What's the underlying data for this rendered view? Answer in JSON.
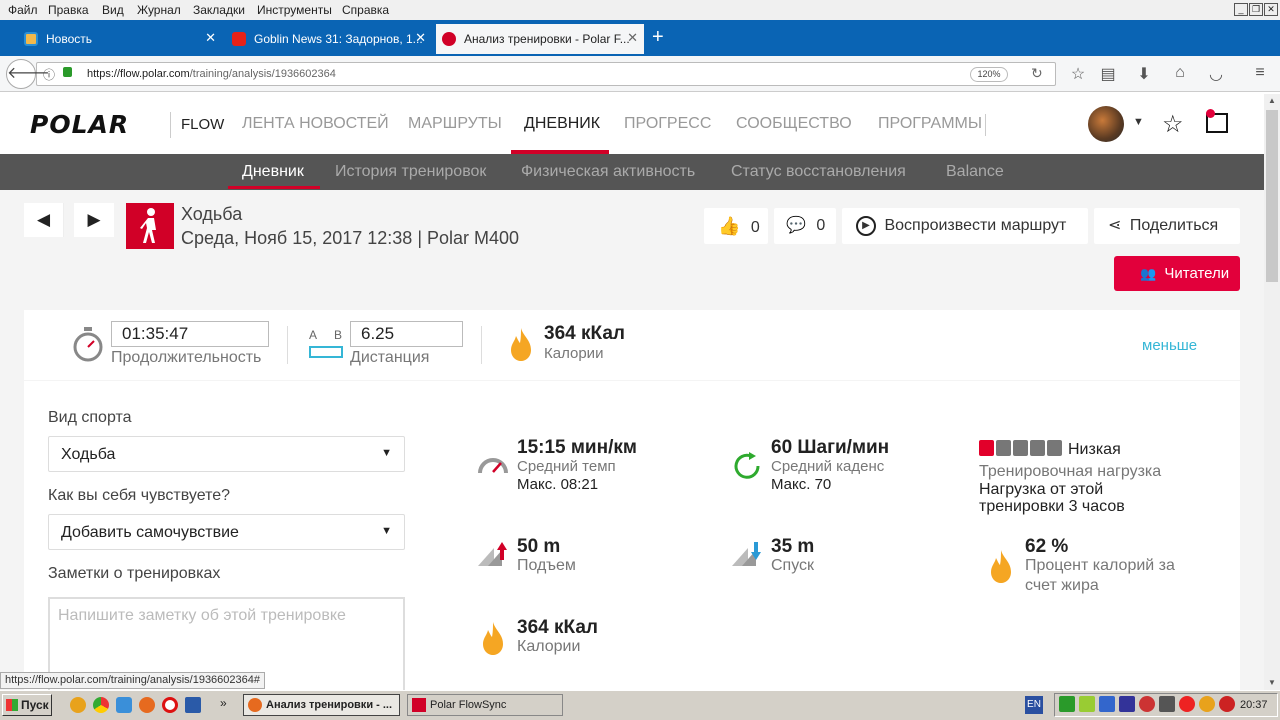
{
  "browser": {
    "menu": [
      "Файл",
      "Правка",
      "Вид",
      "Журнал",
      "Закладки",
      "Инструменты",
      "Справка"
    ],
    "tabs": [
      {
        "title": "Новость",
        "active": false
      },
      {
        "title": "Goblin News 31: Задорнов, 1...",
        "active": false
      },
      {
        "title": "Анализ тренировки - Polar F...",
        "active": true
      }
    ],
    "url_domain": "https://flow.polar.com",
    "url_path": "/training/analysis/1936602364",
    "zoom": "120%"
  },
  "site": {
    "logo": "POLAR",
    "product": "FLOW",
    "nav": [
      "ЛЕНТА НОВОСТЕЙ",
      "МАРШРУТЫ",
      "ДНЕВНИК",
      "ПРОГРЕСС",
      "СООБЩЕСТВО",
      "ПРОГРАММЫ"
    ],
    "active_nav": "ДНЕВНИК",
    "subnav": [
      "Дневник",
      "История тренировок",
      "Физическая активность",
      "Статус восстановления",
      "Balance"
    ],
    "active_subnav": "Дневник"
  },
  "session": {
    "sport": "Ходьба",
    "datetime": "Среда, Нояб 15, 2017 12:38 | Polar M400",
    "likes": "0",
    "comments": "0",
    "replay_label": "Воспроизвести маршрут",
    "share_label": "Поделиться",
    "followers_label": "Читатели"
  },
  "summary": {
    "duration": "01:35:47",
    "duration_label": "Продолжительность",
    "distance_a": "A",
    "distance_b": "B",
    "distance": "6.25",
    "distance_label": "Дистанция",
    "calories": "364 кКал",
    "calories_label": "Калории",
    "less_label": "меньше"
  },
  "form": {
    "sport_label": "Вид спорта",
    "sport_value": "Ходьба",
    "feeling_label": "Как вы себя чувствуете?",
    "feeling_value": "Добавить самочувствие",
    "notes_label": "Заметки о тренировках",
    "notes_placeholder": "Напишите заметку об этой тренировке"
  },
  "metrics": {
    "pace": {
      "value": "15:15 мин/км",
      "label": "Средний темп",
      "max": "Макс. 08:21"
    },
    "cadence": {
      "value": "60 Шаги/мин",
      "label": "Средний каденс",
      "max": "Макс. 70"
    },
    "load": {
      "level": "Низкая",
      "label": "Тренировочная нагрузка",
      "detail_1": "Нагрузка от этой",
      "detail_2": "тренировки 3 часов",
      "filled_segments": 1,
      "total_segments": 5
    },
    "ascent": {
      "value": "50 m",
      "label": "Подъем"
    },
    "descent": {
      "value": "35 m",
      "label": "Спуск"
    },
    "fat": {
      "value": "62 %",
      "label_1": "Процент калорий за",
      "label_2": "счет жира"
    },
    "calories": {
      "value": "364 кКал",
      "label": "Калории"
    }
  },
  "status_url": "https://flow.polar.com/training/analysis/1936602364#",
  "taskbar": {
    "start": "Пуск",
    "tasks": [
      "Анализ тренировки - ...",
      "Polar FlowSync"
    ],
    "lang": "EN",
    "time": "20:37"
  },
  "colors": {
    "brand": "#d10027",
    "accent": "#35b6d6",
    "followers": "#e2003b",
    "flame": "#f5a623"
  }
}
